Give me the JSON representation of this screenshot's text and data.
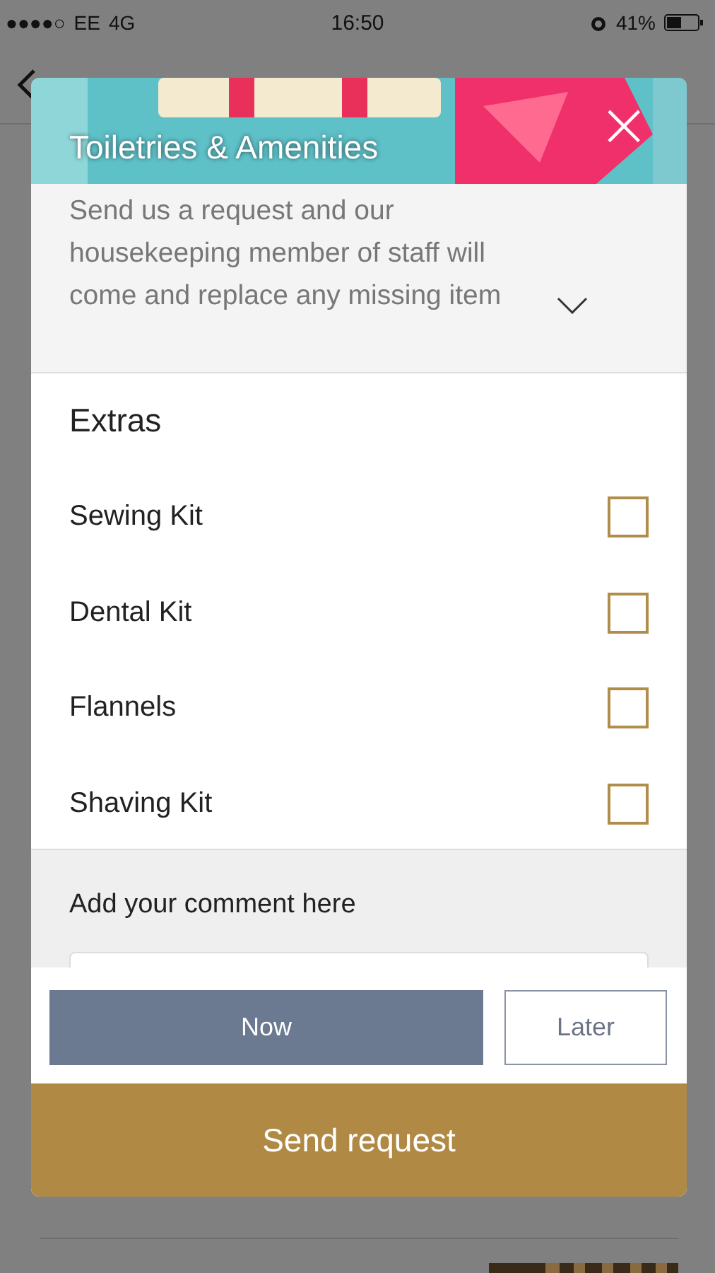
{
  "status_bar": {
    "signal": "●●●●○",
    "carrier": "EE",
    "network": "4G",
    "time": "16:50",
    "battery": "41%"
  },
  "dialog": {
    "title": "Toiletries & Amenities",
    "close": "×",
    "description": "Send us a request and our housekeeping member of staff will come and replace any missing item",
    "section": "Extras",
    "items": [
      {
        "label": "Sewing Kit",
        "checked": false
      },
      {
        "label": "Dental Kit",
        "checked": false
      },
      {
        "label": "Flannels",
        "checked": false
      },
      {
        "label": "Shaving Kit",
        "checked": false
      }
    ],
    "comment_label": "Add your comment here",
    "timing": [
      {
        "label": "Now",
        "selected": true
      },
      {
        "label": "Later",
        "selected": false
      }
    ],
    "submit": "Send request"
  }
}
